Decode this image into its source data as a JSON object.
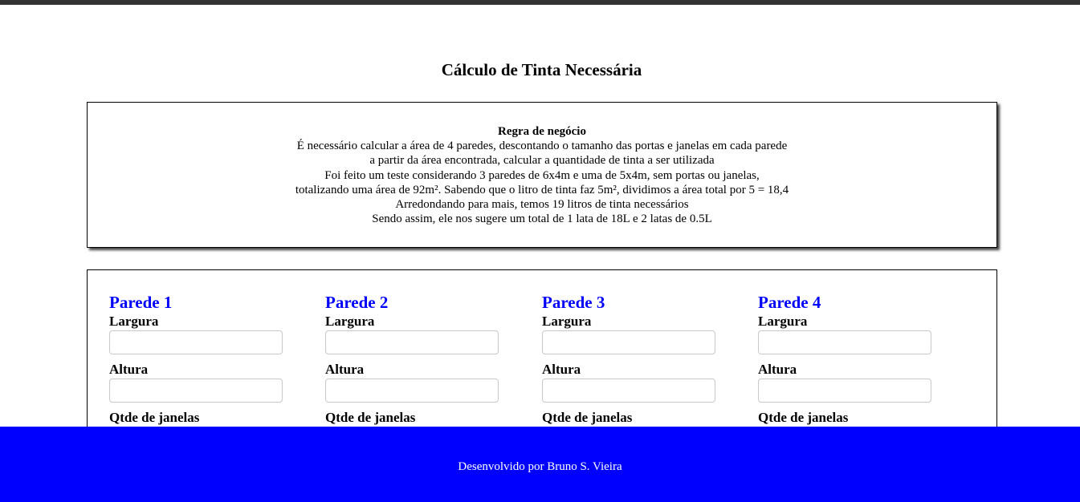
{
  "page": {
    "title": "Cálculo de Tinta Necessária"
  },
  "rules": {
    "title": "Regra de negócio",
    "lines": [
      "É necessário calcular a área de 4 paredes, descontando o tamanho das portas e janelas em cada parede",
      "a partir da área encontrada, calcular a quantidade de tinta a ser utilizada",
      "Foi feito um teste considerando 3 paredes de 6x4m e uma de 5x4m, sem portas ou janelas,",
      "totalizando uma área de 92m². Sabendo que o litro de tinta faz 5m², dividimos a área total por 5 = 18,4",
      "Arredondando para mais, temos 19 litros de tinta necessários",
      "Sendo assim, ele nos sugere um total de 1 lata de 18L e 2 latas de 0.5L"
    ]
  },
  "walls": [
    {
      "title": "Parede 1",
      "width_label": "Largura",
      "width_value": "",
      "height_label": "Altura",
      "height_value": "",
      "windows_label": "Qtde de janelas"
    },
    {
      "title": "Parede 2",
      "width_label": "Largura",
      "width_value": "",
      "height_label": "Altura",
      "height_value": "",
      "windows_label": "Qtde de janelas"
    },
    {
      "title": "Parede 3",
      "width_label": "Largura",
      "width_value": "",
      "height_label": "Altura",
      "height_value": "",
      "windows_label": "Qtde de janelas"
    },
    {
      "title": "Parede 4",
      "width_label": "Largura",
      "width_value": "",
      "height_label": "Altura",
      "height_value": "",
      "windows_label": "Qtde de janelas"
    }
  ],
  "footer": {
    "text": "Desenvolvido por Bruno S. Vieira"
  },
  "colors": {
    "accent": "#0000ff",
    "top_bar": "#333333",
    "footer_bg": "#0000ff",
    "footer_text": "#ffffff"
  }
}
